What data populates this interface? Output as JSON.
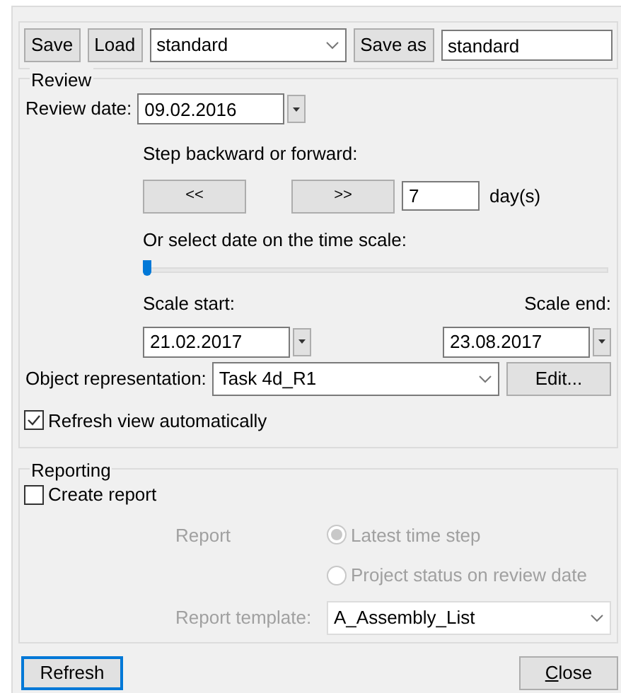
{
  "toolbar": {
    "save": "Save",
    "load": "Load",
    "profile": "standard",
    "save_as": "Save as",
    "save_as_name": "standard"
  },
  "review": {
    "title": "Review",
    "date_label": "Review date:",
    "date": "09.02.2016",
    "step_label": "Step backward or forward:",
    "back": "<<",
    "forward": ">>",
    "step_days": "7",
    "days_unit": "day(s)",
    "scale_label": "Or select date on the time scale:",
    "slider": {
      "level": 0.0
    },
    "scale_start_label": "Scale start:",
    "scale_start": "21.02.2017",
    "scale_end_label": "Scale end:",
    "scale_end": "23.08.2017",
    "object_label": "Object representation:",
    "object_value": "Task 4d_R1",
    "edit": "Edit...",
    "auto_refresh": {
      "label": "Refresh view automatically",
      "checked": true
    }
  },
  "reporting": {
    "title": "Reporting",
    "create_report": {
      "label": "Create report",
      "checked": false
    },
    "disabled": true,
    "report_label": "Report",
    "options": [
      {
        "label": "Latest time step",
        "selected": true
      },
      {
        "label": "Project status on review date",
        "selected": false
      }
    ],
    "template_label": "Report template:",
    "template": "A_Assembly_List"
  },
  "buttons": {
    "refresh": "Refresh",
    "close": "Close"
  }
}
